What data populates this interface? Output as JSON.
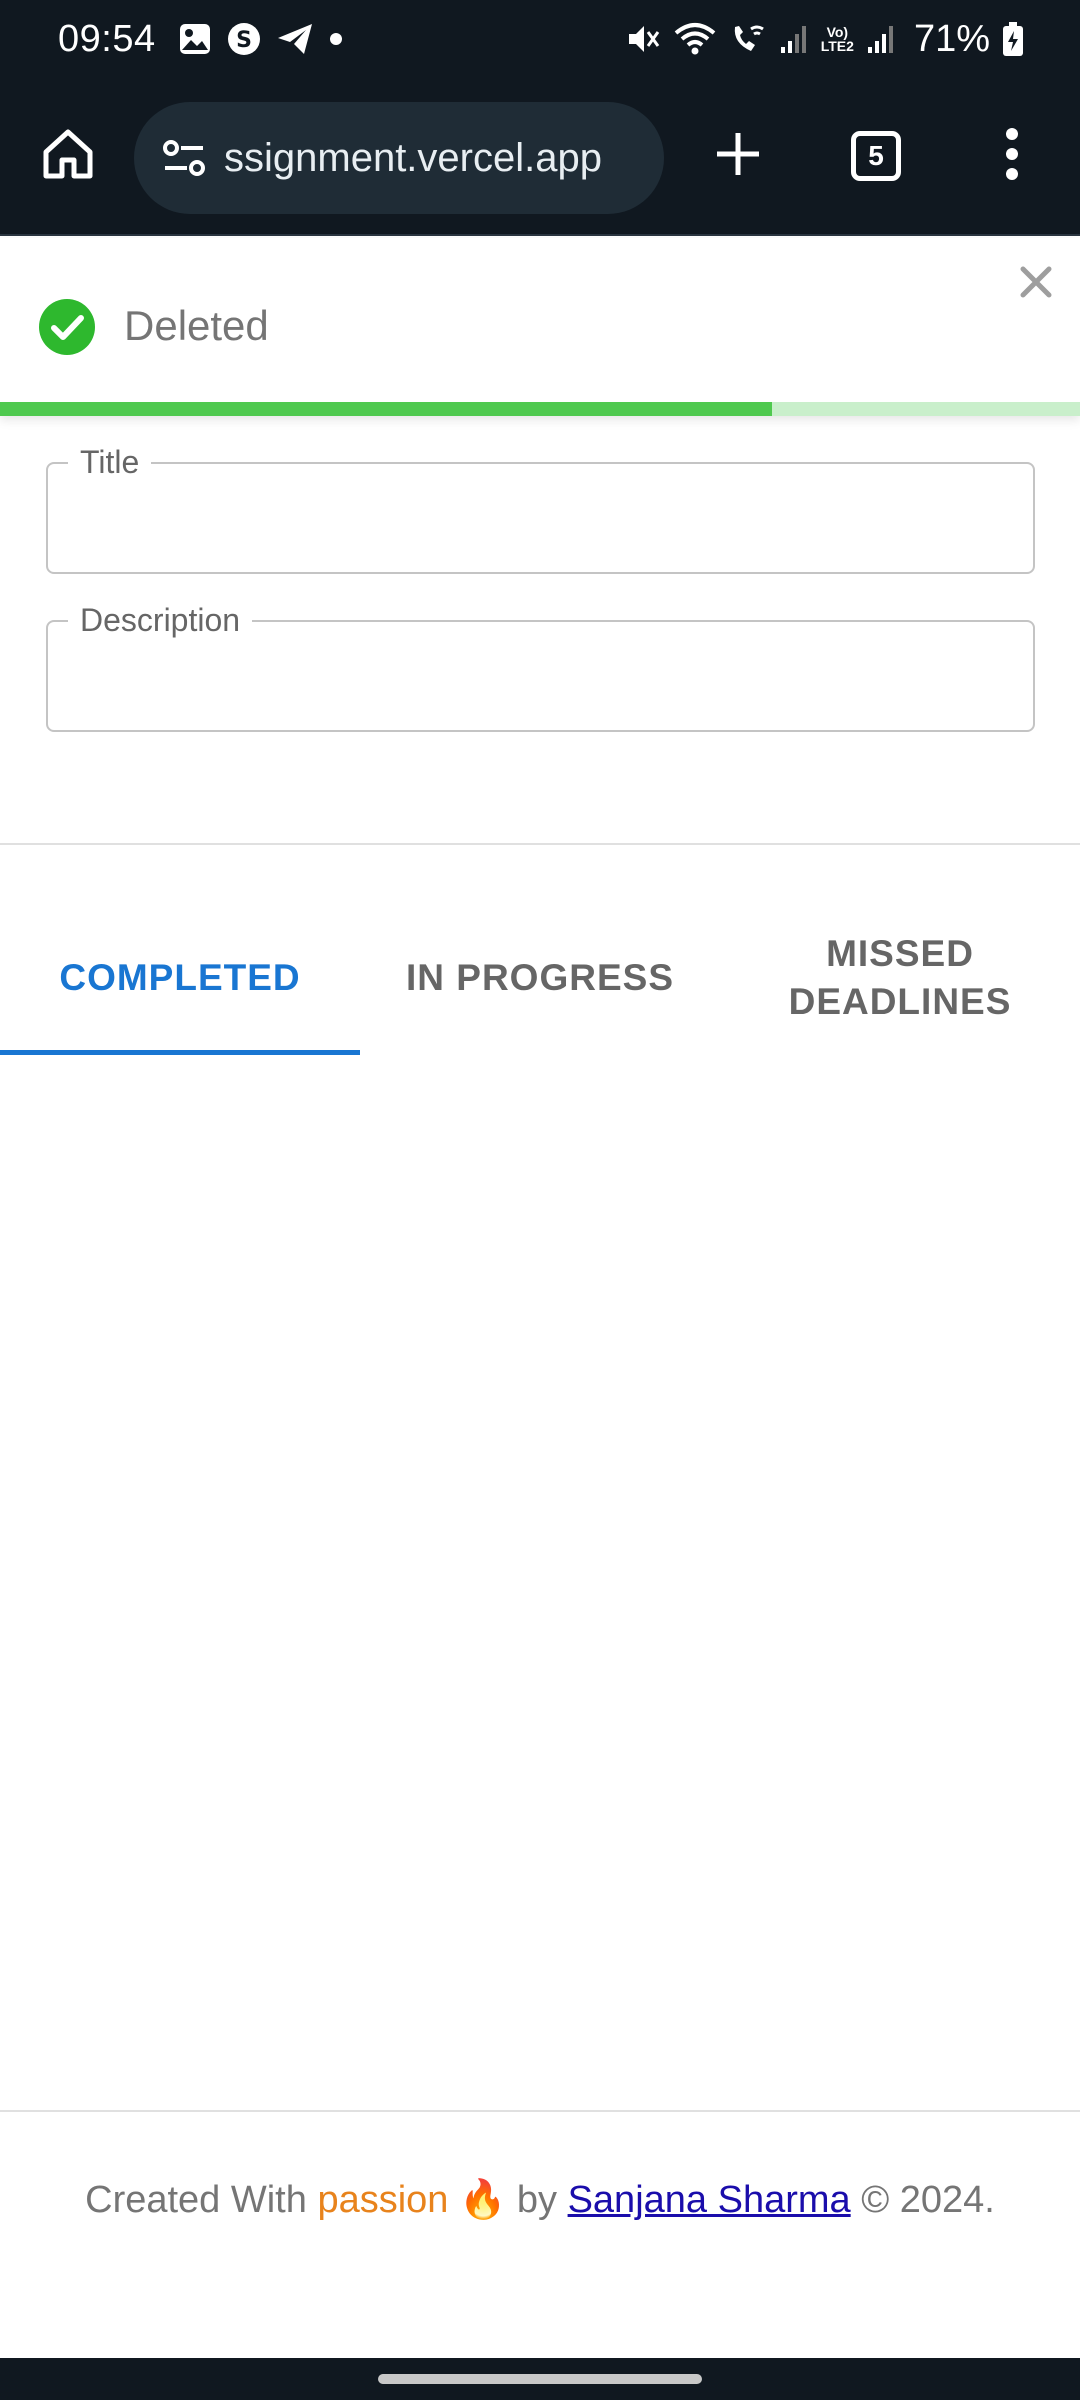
{
  "status_bar": {
    "time": "09:54",
    "battery": "71%",
    "left_icons": [
      "gallery-icon",
      "s-app-icon",
      "telegram-icon",
      "dot-icon"
    ],
    "right_icons": [
      "mute-icon",
      "wifi-icon",
      "wifi-call-icon",
      "signal-icon",
      "volte-icon",
      "signal-icon",
      "battery-charging-icon"
    ],
    "volte_label_1": "Vo)",
    "volte_label_2": "LTE2"
  },
  "browser": {
    "url": "ssignment.vercel.app",
    "tab_count": "5",
    "icons": {
      "home": "home-icon",
      "site_settings": "site-settings-icon",
      "new_tab": "plus-icon",
      "menu": "more-vert-icon"
    }
  },
  "toast": {
    "message": "Deleted",
    "icon": "check-circle-icon",
    "close_icon": "close-icon",
    "progress_fraction": 0.715,
    "colors": {
      "icon": "#2eb82e",
      "progress": "#4fc94f",
      "track": "#c9efcb"
    }
  },
  "form": {
    "title_label": "Title",
    "title_value": "",
    "description_label": "Description",
    "description_value": ""
  },
  "tabs": {
    "items": [
      {
        "label": "COMPLETED",
        "active": true
      },
      {
        "label": "IN PROGRESS",
        "active": false
      },
      {
        "label": "MISSED DEADLINES",
        "active": false
      }
    ],
    "accent_color": "#1976d2"
  },
  "footer": {
    "prefix": "Created With",
    "passion": "passion",
    "emoji": "🔥",
    "by": "by",
    "author": "Sanjana Sharma",
    "suffix": "© 2024."
  }
}
